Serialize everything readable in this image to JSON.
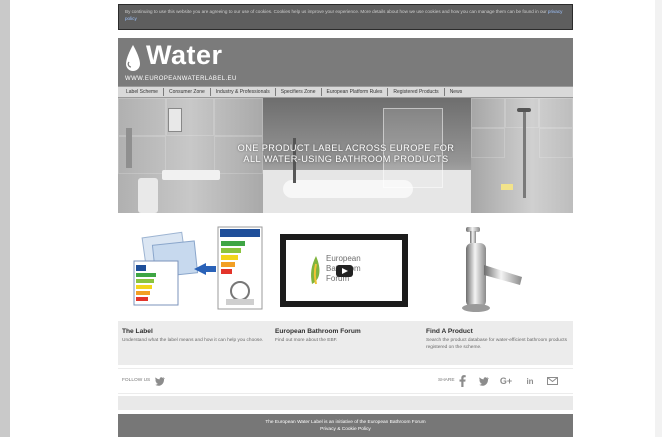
{
  "cookie_notice": {
    "text": "By continuing to use this website you are agreeing to our use of cookies. Cookies help us improve your experience. More details about how we use cookies and how you can manage them can be found in our",
    "link_text": "privacy policy"
  },
  "header": {
    "logo_word": "Water",
    "logo_url": "WWW.EUROPEANWATERLABEL.EU"
  },
  "nav": {
    "items": [
      "Label Scheme",
      "Consumer Zone",
      "Industry & Professionals",
      "Specifiers Zone",
      "European Platform Rules",
      "Registered Products",
      "News"
    ]
  },
  "hero": {
    "caption_line1": "ONE PRODUCT LABEL ACROSS EUROPE FOR",
    "caption_line2": "ALL WATER-USING BATHROOM PRODUCTS"
  },
  "features": {
    "video_brand_line1": "European",
    "video_brand_line2": "Bathroom",
    "video_brand_line3": "Forum"
  },
  "info_boxes": [
    {
      "title": "The Label",
      "text": "Understand what the label means and how it can help you choose."
    },
    {
      "title": "European Bathroom Forum",
      "text": "Find out more about the EBF."
    },
    {
      "title": "Find A Product",
      "text": "Search the product database for water-efficient bathroom products registered on the scheme."
    }
  ],
  "social": {
    "follow_label": "FOLLOW US",
    "share_label": "SHARE",
    "icons": [
      "twitter-icon",
      "facebook-icon",
      "twitter-icon",
      "google-plus-icon",
      "linkedin-icon",
      "email-icon"
    ]
  },
  "footer": {
    "line1": "The European Water Label is an initiative of the European Bathroom Forum",
    "line2": "Privacy & Cookie Policy"
  },
  "colors": {
    "header_bg": "#7b7b7b",
    "nav_bg": "#d9d9d9",
    "cookie_bg": "#5e5e5e",
    "footer_bg": "#777777"
  }
}
